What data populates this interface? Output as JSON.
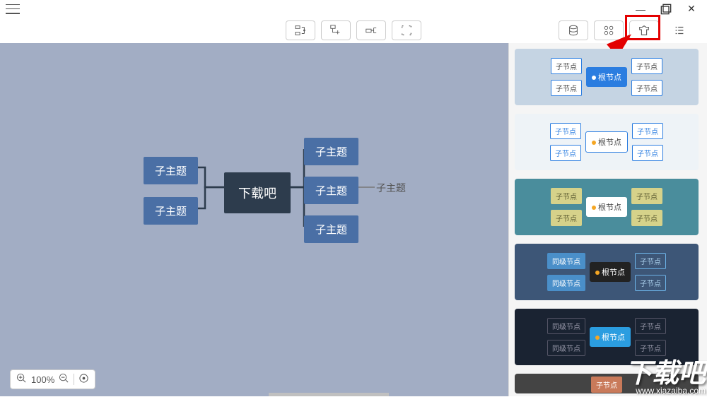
{
  "titlebar": {
    "min": "—",
    "max": "▢",
    "close": "✕"
  },
  "toolbar_center": [
    "insert-sibling",
    "insert-child",
    "layout",
    "focus"
  ],
  "toolbar_right": [
    "storage",
    "grid",
    "theme",
    "list"
  ],
  "mindmap": {
    "root": "下载吧",
    "left": [
      "子主题",
      "子主题"
    ],
    "right": [
      "子主题",
      "子主题",
      "子主题"
    ],
    "leaf": "子主题"
  },
  "themes": [
    {
      "bg": "",
      "root_label": "根节点",
      "root_style": "background:#2b7de0;color:#fff;",
      "mini_label": "子节点",
      "mini_style": "background:#fff;border-color:#2b7de0;color:#444;"
    },
    {
      "bg": "bg2",
      "root_label": "根节点",
      "root_style": "background:#fff;border:1px solid #2b7de0;color:#444;",
      "mini_label": "子节点",
      "mini_style": "background:#fff;border-color:#2b7de0;color:#2b7de0;",
      "dot": "background:#f5a623;"
    },
    {
      "bg": "bg3",
      "root_label": "根节点",
      "root_style": "background:#fff;color:#444;",
      "mini_label": "子节点",
      "mini_style": "background:#d6d28a;border-color:#d6d28a;color:#5a5a30;",
      "dot": "background:#f5a623;"
    },
    {
      "bg": "bg4",
      "root_label": "根节点",
      "root_style": "background:#222;color:#fff;",
      "mini_label": "同级节点",
      "mini_style": "background:#4a8fc9;border-color:#4a8fc9;color:#fff;",
      "mini2": "子节点",
      "mini2_style": "background:transparent;border-color:#6db3e8;color:#aed4f0;"
    },
    {
      "bg": "bg5",
      "root_label": "根节点",
      "root_style": "background:#2b9de0;color:#fff;",
      "mini_label": "同级节点",
      "mini_style": "background:transparent;border-color:#556;color:#99a;",
      "mini2": "子节点",
      "mini2_style": "background:transparent;border-color:#556;color:#99a;"
    }
  ],
  "zoom": {
    "level": "100%"
  },
  "watermark": {
    "text": "下载吧",
    "url": "www.xiazaiba.com"
  },
  "partial_theme_mini": "子节点"
}
